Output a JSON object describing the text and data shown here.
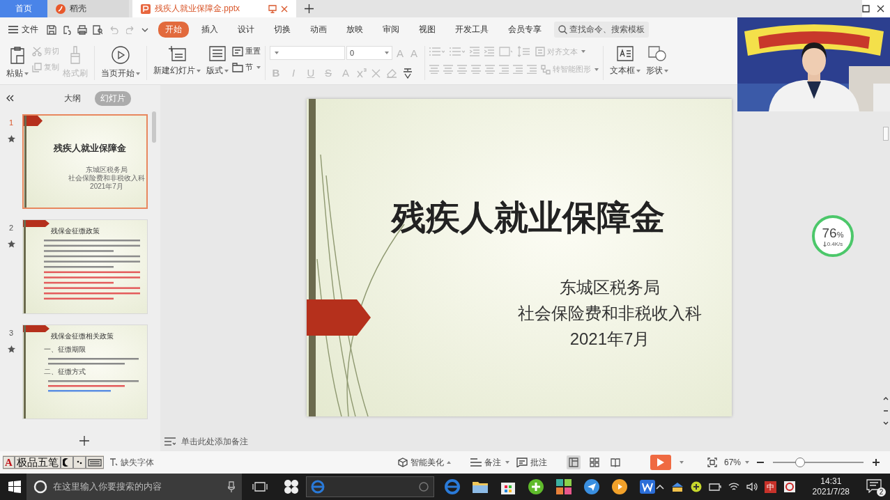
{
  "tabs": [
    {
      "label": "首页",
      "kind": "home",
      "selected": false
    },
    {
      "label": "稻壳",
      "kind": "docer",
      "selected": false
    },
    {
      "label": "残疾人就业保障金.pptx",
      "kind": "document",
      "selected": true
    }
  ],
  "menu": {
    "file": "文件",
    "tabs": [
      {
        "label": "开始",
        "selected": true
      },
      {
        "label": "插入",
        "selected": false
      },
      {
        "label": "设计",
        "selected": false
      },
      {
        "label": "切换",
        "selected": false
      },
      {
        "label": "动画",
        "selected": false
      },
      {
        "label": "放映",
        "selected": false
      },
      {
        "label": "审阅",
        "selected": false
      },
      {
        "label": "视图",
        "selected": false
      },
      {
        "label": "开发工具",
        "selected": false
      },
      {
        "label": "会员专享",
        "selected": false
      }
    ],
    "search_placeholder": "查找命令、搜索模板"
  },
  "ribbon": {
    "paste": "粘贴",
    "cut": {
      "label": "剪切",
      "disabled": true
    },
    "copy": {
      "label": "复制",
      "disabled": true
    },
    "format_painter": {
      "label": "格式刷",
      "disabled": true
    },
    "play_from_current": "当页开始",
    "new_slide": "新建幻灯片",
    "layout": "版式",
    "reset": "重置",
    "section": "节",
    "font_size": "0",
    "grow_font": "A",
    "shrink_font": "A",
    "format_buttons": [
      {
        "label": "B",
        "disabled": true
      },
      {
        "label": "I",
        "disabled": true
      },
      {
        "label": "U",
        "disabled": true
      },
      {
        "label": "S",
        "disabled": true
      },
      {
        "label": "A",
        "disabled": true
      }
    ],
    "align_text": {
      "label": "对齐文本",
      "disabled": true
    },
    "smart_art": {
      "label": "转智能图形",
      "disabled": true
    },
    "text_box": "文本框",
    "shape": "形状"
  },
  "sidebar": {
    "tabs": [
      {
        "label": "大纲",
        "selected": false
      },
      {
        "label": "幻灯片",
        "selected": true
      }
    ]
  },
  "thumbnails": [
    {
      "number": "1",
      "selected": true,
      "kind": "title",
      "title": "残疾人就业保障金",
      "lines": [
        "东城区税务局",
        "社会保险费和非税收入科",
        "2021年7月"
      ]
    },
    {
      "number": "2",
      "selected": false,
      "kind": "content",
      "title": "残保金征缴政策"
    },
    {
      "number": "3",
      "selected": false,
      "kind": "content",
      "title": "残保金征缴相关政策",
      "bullets": [
        "一、征缴期限",
        "二、征缴方式"
      ]
    }
  ],
  "slide": {
    "title": "残疾人就业保障金",
    "lines": [
      "东城区税务局",
      "社会保险费和非税收入科",
      "2021年7月"
    ]
  },
  "notes_placeholder": "单击此处添加备注",
  "speed_widget": {
    "percent": "76",
    "unit": "%",
    "rate": "0.4K/s"
  },
  "status": {
    "ime": {
      "logo": "A",
      "name": "极品五笔"
    },
    "missing_font": "缺失字体",
    "beautify": "智能美化",
    "notes": "备注",
    "comments": "批注",
    "views": [
      {
        "selected": true
      },
      {
        "selected": false
      },
      {
        "selected": false
      }
    ],
    "zoom": "67%",
    "zoom_slider": {
      "level": 0.3
    }
  },
  "taskbar": {
    "search_placeholder": "在这里输入你要搜索的内容",
    "ime": "中",
    "time": "14:31",
    "date": "2021/7/28",
    "notifications": "2"
  }
}
